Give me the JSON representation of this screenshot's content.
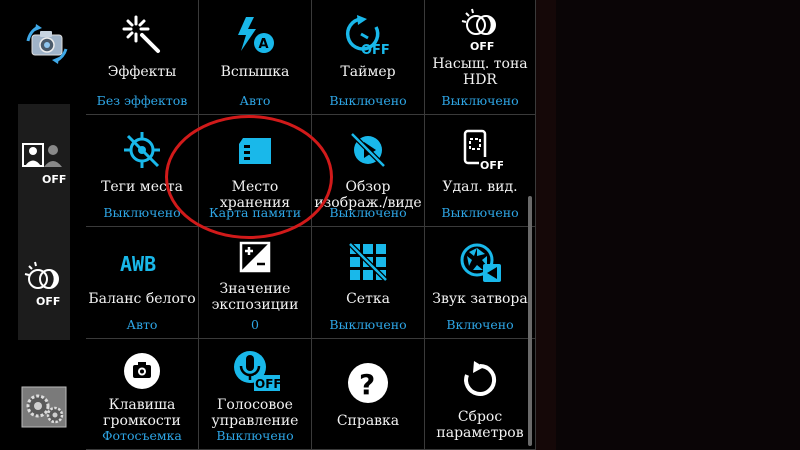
{
  "sidebar": {
    "buttons": [
      {
        "name": "camera-switch-icon"
      },
      {
        "name": "face-detection-off-icon",
        "badge": "OFF"
      },
      {
        "name": "hdr-off-icon",
        "badge": "OFF"
      },
      {
        "name": "settings-gear-icon"
      }
    ]
  },
  "settings": [
    {
      "label": "Эффекты",
      "value": "Без эффектов"
    },
    {
      "label": "Вспышка",
      "value": "Авто"
    },
    {
      "label": "Таймер",
      "value": "Выключено",
      "badge": "OFF"
    },
    {
      "label": "Насыщ. тона\nHDR",
      "value": "Выключено",
      "badge": "OFF"
    },
    {
      "label": "Теги места",
      "value": "Выключено"
    },
    {
      "label": "Место\nхранения",
      "value": "Карта памяти"
    },
    {
      "label": "Обзор\nизображ./виде",
      "value": "Выключено"
    },
    {
      "label": "Удал. вид.",
      "value": "Выключено",
      "badge": "OFF"
    },
    {
      "label": "Баланс белого",
      "value": "Авто",
      "badge": "AWB"
    },
    {
      "label": "Значение\nэкспозиции",
      "value": "0"
    },
    {
      "label": "Сетка",
      "value": "Выключено"
    },
    {
      "label": "Звук затвора",
      "value": "Включено"
    },
    {
      "label": "Клавиша\nгромкости",
      "value": "Фотосъемка"
    },
    {
      "label": "Голосовое\nуправление",
      "value": "Выключено",
      "badge": "OFF"
    },
    {
      "label": "Справка",
      "value": ""
    },
    {
      "label": "Сброс\nпараметров",
      "value": ""
    }
  ],
  "colors": {
    "accent": "#2ea6e6",
    "icon_cyan": "#19b8ea",
    "highlight_red": "#d11a1a"
  }
}
